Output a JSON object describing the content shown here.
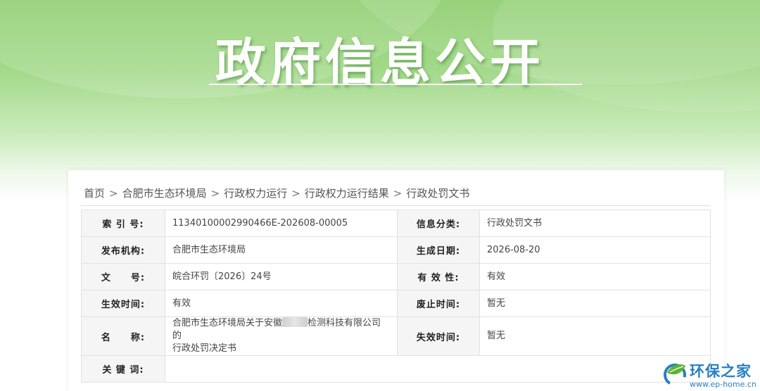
{
  "banner": {
    "title": "政府信息公开"
  },
  "breadcrumb": {
    "items": [
      "首页",
      "合肥市生态环境局",
      "行政权力运行",
      "行政权力运行结果",
      "行政处罚文书"
    ],
    "separator": ">"
  },
  "meta": {
    "index_label": "索 引 号:",
    "index_value": "11340100002990466E-202608-00005",
    "category_label": "信息分类:",
    "category_value": "行政处罚文书",
    "publisher_label": "发布机构:",
    "publisher_value": "合肥市生态环境局",
    "created_label": "生成日期:",
    "created_value": "2026-08-20",
    "docno_label": "文　　号:",
    "docno_value": "皖合环罚〔2026〕24号",
    "validity_label": "有 效 性:",
    "validity_value": "有效",
    "effective_label": "生效时间:",
    "effective_value": "有效",
    "repeal_label": "废止时间:",
    "repeal_value": "暂无",
    "name_label": "名　　称:",
    "name_value_part1": "合肥市生态环境局关于安徽",
    "name_value_part2": "检测科技有限公司的",
    "name_value_line2": "行政处罚决定书",
    "expire_label": "失效时间:",
    "expire_value": "暂无",
    "keywords_label": "关 键 词:",
    "keywords_value": ""
  },
  "logo": {
    "name": "环保之家",
    "url": "www.ep-home.cn",
    "icon": "leaf-ring-logo-icon"
  },
  "colors": {
    "banner_green": "#8ccd6c",
    "logo_blue": "#2a7fc1",
    "logo_green": "#5cb531"
  }
}
